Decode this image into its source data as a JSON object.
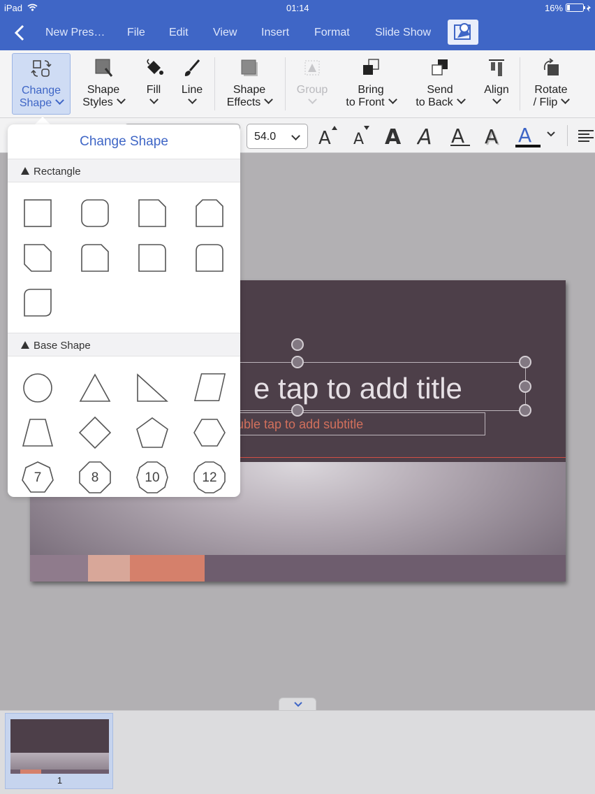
{
  "status": {
    "device": "iPad",
    "time": "01:14",
    "battery": "16%"
  },
  "menu": {
    "doc_title": "New Pres…",
    "items": [
      "File",
      "Edit",
      "View",
      "Insert",
      "Format",
      "Slide Show"
    ]
  },
  "ribbon": {
    "change_shape": [
      "Change",
      "Shape"
    ],
    "shape_styles": [
      "Shape",
      "Styles"
    ],
    "fill": "Fill",
    "line": "Line",
    "shape_effects": [
      "Shape",
      "Effects"
    ],
    "group": "Group",
    "bring_front": [
      "Bring",
      "to Front"
    ],
    "send_back": [
      "Send",
      "to Back"
    ],
    "align": "Align",
    "rotate": [
      "Rotate",
      "/ Flip"
    ]
  },
  "fontbar": {
    "size": "54.0"
  },
  "popover": {
    "title": "Change Shape",
    "sections": [
      "Rectangle",
      "Base Shape"
    ],
    "polygon_labels": [
      "7",
      "8",
      "10",
      "12"
    ]
  },
  "slide": {
    "title_placeholder": "e tap to add title",
    "subtitle_placeholder": "uble tap to add subtitle"
  },
  "thumbnails": [
    {
      "number": "1"
    }
  ],
  "colors": {
    "accent": "#3f66c6",
    "selected_tool": "#cfdcf4",
    "slide_bg": "#4d3f49",
    "subtitle_text": "#d2705c"
  }
}
